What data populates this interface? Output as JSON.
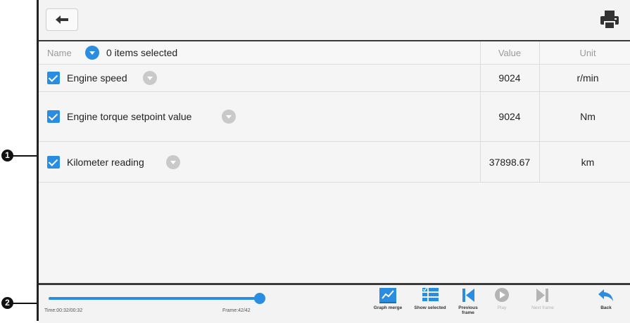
{
  "callouts": {
    "one": "1",
    "two": "2"
  },
  "header": {
    "back_icon": "back-arrow-icon",
    "print_icon": "printer-icon"
  },
  "table": {
    "col_name": "Name",
    "selected_text": "0 items selected",
    "col_value": "Value",
    "col_unit": "Unit",
    "rows": [
      {
        "name": "Engine speed",
        "value": "9024",
        "unit": "r/min",
        "checked": true
      },
      {
        "name": "Engine torque setpoint value",
        "value": "9024",
        "unit": "Nm",
        "checked": true
      },
      {
        "name": "Kilometer reading",
        "value": "37898.67",
        "unit": "km",
        "checked": true
      }
    ]
  },
  "playback": {
    "time_label": "Time:00:32/00:32",
    "frame_label": "Frame:42/42",
    "progress_fraction": 1.0,
    "controls": {
      "graph_merge": "Graph merge",
      "show_selected": "Show selected",
      "previous_frame": "Previous frame",
      "play": "Play",
      "next_frame": "Next frame",
      "back": "Back"
    }
  },
  "colors": {
    "accent": "#2b8de0",
    "disabled": "#b4b4b4"
  }
}
